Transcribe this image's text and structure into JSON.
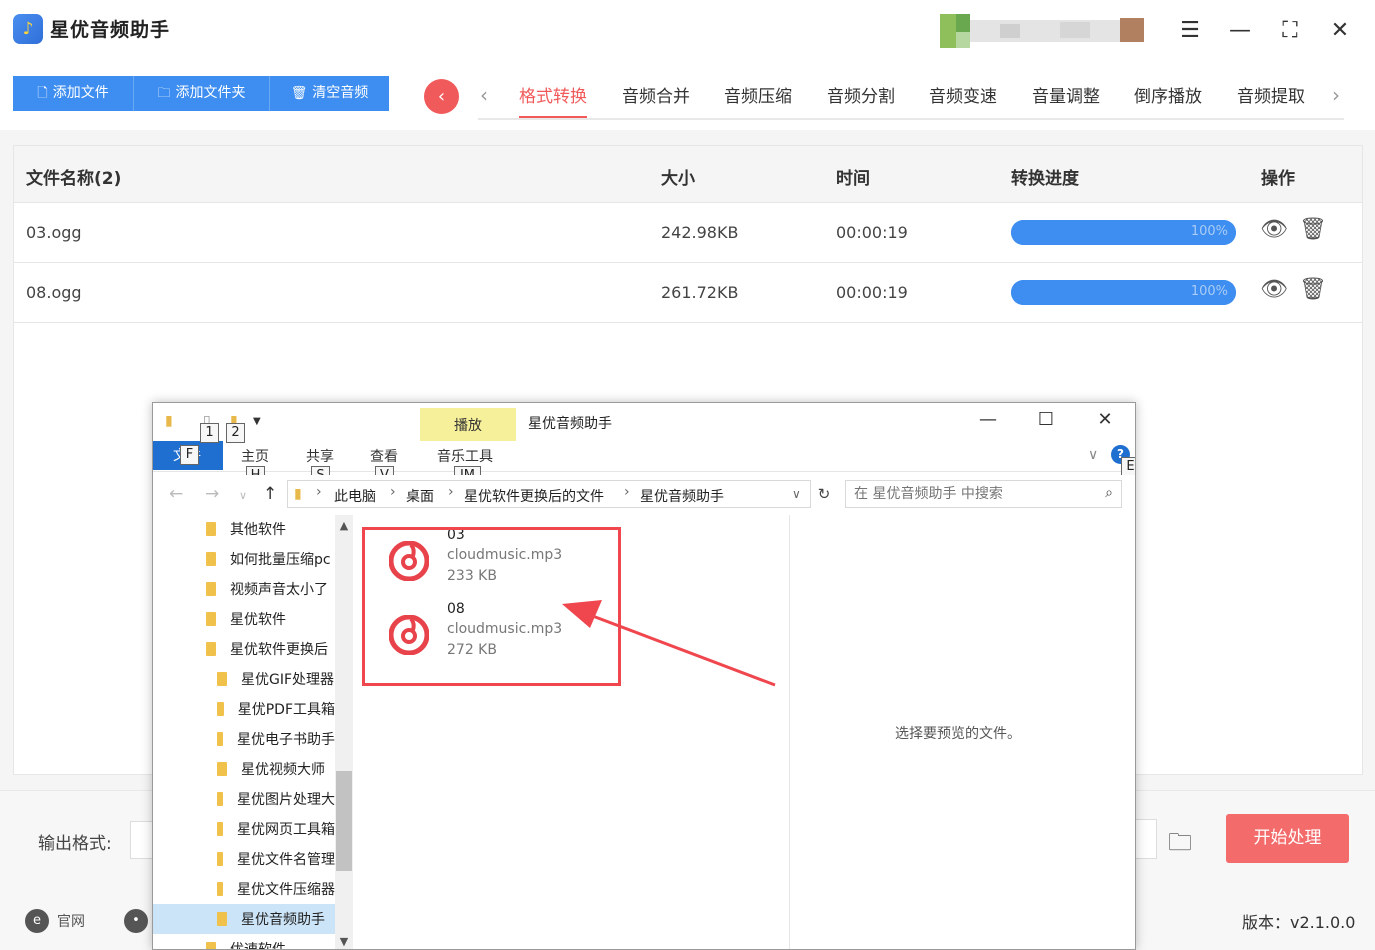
{
  "app": {
    "title": "星优音频助手",
    "logo_icon": "music-note-icon",
    "window_controls": [
      "settings-sliders-icon",
      "minimize-icon",
      "fullscreen-icon",
      "close-icon"
    ]
  },
  "toolbar": {
    "add_file": "添加文件",
    "add_folder": "添加文件夹",
    "clear_audio": "清空音频"
  },
  "tabs": {
    "items": [
      "格式转换",
      "音频合并",
      "音频压缩",
      "音频分割",
      "音频变速",
      "音量调整",
      "倒序播放",
      "音频提取"
    ],
    "active": "格式转换"
  },
  "table": {
    "headers": {
      "name": "文件名称(2)",
      "size": "大小",
      "time": "时间",
      "progress": "转换进度",
      "ops": "操作"
    },
    "rows": [
      {
        "name": "03.ogg",
        "size": "242.98KB",
        "time": "00:00:19",
        "progress": 1.0,
        "progress_label": "100%"
      },
      {
        "name": "08.ogg",
        "size": "261.72KB",
        "time": "00:00:19",
        "progress": 1.0,
        "progress_label": "100%"
      }
    ]
  },
  "output": {
    "format_label": "输出格式:",
    "start_button": "开始处理"
  },
  "footer": {
    "website": "官网",
    "version": "版本：v2.1.0.0"
  },
  "explorer": {
    "title": "星优音频助手",
    "play_tab": "播放",
    "ribbon": {
      "file": "文件",
      "home": "主页",
      "share": "共享",
      "view": "查看",
      "music_tools": "音乐工具"
    },
    "keytips": {
      "qa1": "1",
      "qa2": "2",
      "file": "F",
      "home": "H",
      "share": "S",
      "view": "V",
      "music": "JM",
      "help": "E"
    },
    "breadcrumbs": [
      "此电脑",
      "桌面",
      "星优软件更换后的文件",
      "星优音频助手"
    ],
    "search_placeholder": "在 星优音频助手 中搜索",
    "tree": [
      {
        "label": "其他软件",
        "indent": 0
      },
      {
        "label": "如何批量压缩pc",
        "indent": 0
      },
      {
        "label": "视频声音太小了",
        "indent": 0
      },
      {
        "label": "星优软件",
        "indent": 0
      },
      {
        "label": "星优软件更换后",
        "indent": 0
      },
      {
        "label": "星优GIF处理器",
        "indent": 1
      },
      {
        "label": "星优PDF工具箱",
        "indent": 1
      },
      {
        "label": "星优电子书助手",
        "indent": 1
      },
      {
        "label": "星优视频大师",
        "indent": 1
      },
      {
        "label": "星优图片处理大",
        "indent": 1
      },
      {
        "label": "星优网页工具箱",
        "indent": 1
      },
      {
        "label": "星优文件名管理",
        "indent": 1
      },
      {
        "label": "星优文件压缩器",
        "indent": 1
      },
      {
        "label": "星优音频助手",
        "indent": 1,
        "selected": true
      },
      {
        "label": "优速软件",
        "indent": 0
      }
    ],
    "files": [
      {
        "name": "03",
        "type": "cloudmusic.mp3",
        "size": "233 KB"
      },
      {
        "name": "08",
        "type": "cloudmusic.mp3",
        "size": "272 KB"
      }
    ],
    "preview_text": "选择要预览的文件。"
  },
  "colors": {
    "accent_blue": "#3d8ef0",
    "accent_red": "#f05a5a",
    "start_button": "#f46b6b",
    "highlight": "#f0464e",
    "explorer_blue": "#1f6fd1",
    "play_tab": "#f6f09a"
  }
}
